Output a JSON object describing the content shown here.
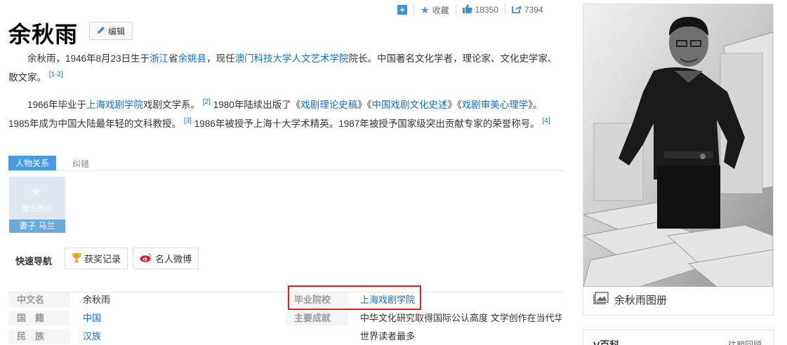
{
  "actions": {
    "favorite_label": "收藏",
    "like_count": "18350",
    "share_count": "7394"
  },
  "title": "余秋雨",
  "edit_label": "编辑",
  "intro": {
    "t1": "余秋雨，1946年8月23日生于",
    "l1": "浙江",
    "t2": "省",
    "l2": "余姚县",
    "t3": "，现任",
    "l3": "澳门科技大学人文艺术学院",
    "t4": "院长。中国著名文化学者，理论家、文化史学家、散文家。",
    "ref": "[1-2]"
  },
  "career": {
    "t1": "1966年毕业于",
    "l1": "上海戏剧学院",
    "t2": "戏剧文学系。",
    "ref1": "[2]",
    "t3": " 1980年陆续出版了《",
    "l2": "戏剧理论史稿",
    "t4": "》《",
    "l3": "中国戏剧文化史述",
    "t5": "》《",
    "l4": "戏剧审美心理学",
    "t6": "》。1985年成为中国大陆最年轻的文科教授。",
    "ref2": "[3]",
    "t7": " 1986年被授予上海十大学术精英。1987年被授予国家级突出贡献专家的荣誉称号。",
    "ref3": "[4]"
  },
  "relations": {
    "tab_label": "人物关系",
    "correct_label": "纠错",
    "card_noimg": "暂无图片",
    "card_caption": "妻子 马兰"
  },
  "quick_nav": {
    "label": "快速导航",
    "btn1": "获奖记录",
    "btn2": "名人微博"
  },
  "info": {
    "r1": {
      "label": "中文名",
      "value": "余秋雨",
      "label2": "毕业院校",
      "value2": "上海戏剧学院"
    },
    "r2": {
      "label": "国　籍",
      "value": "中国",
      "label2": "主要成就",
      "value2": "中华文化研究取得国际公认高度 文学创作在当代华文"
    },
    "r3": {
      "label": "民　族",
      "value": "汉族",
      "value2": "世界读者最多"
    }
  },
  "sidebar": {
    "album_label": "余秋雨图册",
    "v_title": "V百科",
    "v_more": "往期回顾"
  },
  "colors": {
    "link": "#136ec2",
    "tab_blue": "#4a9ae1",
    "highlight_red": "#e02020"
  }
}
